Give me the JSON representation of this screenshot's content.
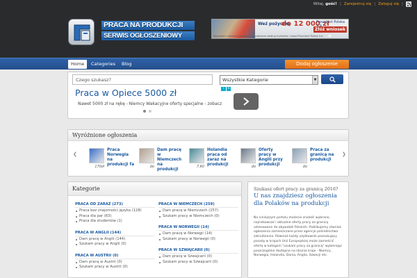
{
  "topbar": {
    "greeting": "Witaj,",
    "guest": "gość!",
    "register": "Zarejestruj się",
    "separator": "|",
    "login": "Zaloguj się"
  },
  "logo": {
    "line1": "PRACA NA PRODUKCJI",
    "line2": "SERWIS OGŁOSZENIOWY"
  },
  "banner": {
    "headline": "Weź pożyczkę",
    "amount": "do 12 000 zł",
    "brand": "Provident Polska S.A.",
    "cta": "Złóż wniosek ►",
    "footnote": "Wszystkim udzielone pożyczki są udzielane według kryteriów i zasad Provident Polska S.A."
  },
  "nav": {
    "home": "Home",
    "categories": "Categories",
    "blog": "Blog",
    "add_listing": "Dodaj ogłoszenie"
  },
  "search": {
    "placeholder": "Czego szukasz?",
    "category_selected": "Wszystkie Kategorie"
  },
  "ad": {
    "title": "Praca w Opiece 5000 zł",
    "subtitle": "Nawet 5000 zł na rękę - Niemcy Wakacyjne oferty specjalne - zobacz",
    "info": "i",
    "close": "x"
  },
  "featured": {
    "title": "Wyróżnione ogłoszenia",
    "items": [
      {
        "title": "Praca Norwegia na produkcji fa",
        "price": "170zł",
        "color": "#3b6fc8"
      },
      {
        "title": "Dam pracę w Niemczech na produkcji",
        "price": "do",
        "color": "#b0a090"
      },
      {
        "title": "Holandia praca od zaraz na produkcji",
        "price": "7,60",
        "color": "#4a8a9a"
      },
      {
        "title": "Oferty pracy w Anglii przy produkcji",
        "price": "do",
        "color": "#6a7a8a"
      },
      {
        "title": "Praca za granicą na produkcji",
        "price": "do",
        "color": "#8aa0b8"
      }
    ]
  },
  "categories": {
    "title": "Kategorie",
    "left": [
      {
        "head": "PRACA OD ZARAZ (273)",
        "subs": [
          "Praca bez znajomości języka (128)",
          "Praca dla par (63)",
          "Praca dla studentów (1)"
        ]
      },
      {
        "head": "PRACA W ANGLII (144)",
        "subs": [
          "Dam pracę w Anglii (144)",
          "Szukam pracy w Anglii (0)"
        ]
      },
      {
        "head": "PRACA W AUSTRII (0)",
        "subs": [
          "Dam pracę w Austrii (0)",
          "Szukam pracy w Austrii (0)"
        ]
      }
    ],
    "right": [
      {
        "head": "PRACA W NIEMCZECH (259)",
        "subs": [
          "Dam pracę w Niemczech (257)",
          "Szukam pracy w Niemczech (0)"
        ]
      },
      {
        "head": "PRACA W NORWEGII (14)",
        "subs": [
          "Dam pracę w Norwegii (14)",
          "Szukam pracy w Norwegii (0)"
        ]
      },
      {
        "head": "PRACA W SZWAJCARII (0)",
        "subs": [
          "Dam pracę w Szwajcarii (0)",
          "Szukam pracy w Szwajcarii (0)"
        ]
      }
    ]
  },
  "info": {
    "question": "Szukasz ofert pracy za granicą 2016?",
    "heading": "U nas znajdziesz ogłoszenia dla Polaków na produkcji",
    "paragraph": "Na niniejszym portalu możecie znaleźć wybrane, najciekawsze i aktualne oferty pracy za granicą adresowane do obywateli Polskich. Publikujemy również ogłoszenia zamieszczane przez agencje pośrednictwa zatrudnienia. Również każdy użytkownik poszukujący posady w krajach Unii Europejskiej może zamieścić ofertę w kategorii \"szukam pracy za granicą\" wybierając poszczególne dostępne na stronie kraje - Niemcy, Norwegia, Holandia, Dania, Anglia, Szwecji etc."
  }
}
